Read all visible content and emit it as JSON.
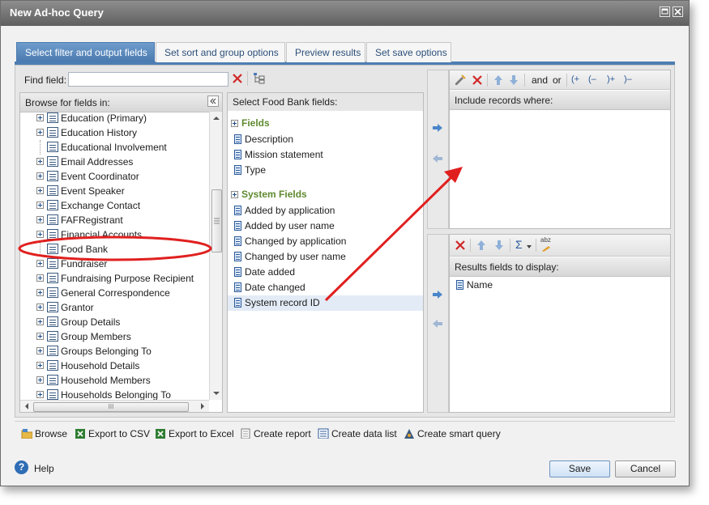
{
  "window": {
    "title": "New Ad-hoc Query"
  },
  "tabs": [
    {
      "label": "Select filter and output fields",
      "active": true
    },
    {
      "label": "Set sort and group options",
      "active": false
    },
    {
      "label": "Preview results",
      "active": false
    },
    {
      "label": "Set save options",
      "active": false
    }
  ],
  "find": {
    "label": "Find field:",
    "value": "",
    "placeholder": ""
  },
  "browse": {
    "header": "Browse for fields in:",
    "items": [
      {
        "label": "Education (Primary)",
        "expandable": true
      },
      {
        "label": "Education History",
        "expandable": true
      },
      {
        "label": "Educational Involvement",
        "expandable": false
      },
      {
        "label": "Email Addresses",
        "expandable": true
      },
      {
        "label": "Event Coordinator",
        "expandable": true
      },
      {
        "label": "Event Speaker",
        "expandable": true
      },
      {
        "label": "Exchange Contact",
        "expandable": true
      },
      {
        "label": "FAFRegistrant",
        "expandable": true
      },
      {
        "label": "Financial Accounts",
        "expandable": true
      },
      {
        "label": "Food Bank",
        "expandable": false,
        "selected": true
      },
      {
        "label": "Fundraiser",
        "expandable": true
      },
      {
        "label": "Fundraising Purpose Recipient",
        "expandable": true
      },
      {
        "label": "General Correspondence",
        "expandable": true
      },
      {
        "label": "Grantor",
        "expandable": true
      },
      {
        "label": "Group Details",
        "expandable": true
      },
      {
        "label": "Group Members",
        "expandable": true
      },
      {
        "label": "Groups Belonging To",
        "expandable": true
      },
      {
        "label": "Household Details",
        "expandable": true
      },
      {
        "label": "Household Members",
        "expandable": true
      },
      {
        "label": "Households Belonging To",
        "expandable": true
      }
    ],
    "hscroll_grip": "III"
  },
  "select_fields": {
    "header": "Select Food Bank fields:",
    "groups": [
      {
        "title": "Fields",
        "items": [
          "Description",
          "Mission statement",
          "Type"
        ]
      },
      {
        "title": "System Fields",
        "items": [
          "Added by application",
          "Added by user name",
          "Changed by application",
          "Changed by user name",
          "Date added",
          "Date changed",
          "System record ID"
        ]
      }
    ],
    "selected": "System record ID"
  },
  "filter": {
    "toolbar": {
      "and": "and",
      "or": "or",
      "open_paren_add": "(+",
      "open_paren_remove": "(–",
      "close_paren_add": ")+",
      "close_paren_remove": ")–"
    },
    "header": "Include records where:"
  },
  "results": {
    "header": "Results fields to display:",
    "sigma": "Σ",
    "sort_label": "abz",
    "items": [
      "Name"
    ]
  },
  "bottom_actions": [
    {
      "label": "Browse",
      "icon": "browse-folder-icon"
    },
    {
      "label": "Export to CSV",
      "icon": "excel-csv-icon"
    },
    {
      "label": "Export to Excel",
      "icon": "excel-icon"
    },
    {
      "label": "Create report",
      "icon": "report-icon"
    },
    {
      "label": "Create data list",
      "icon": "data-list-icon"
    },
    {
      "label": "Create smart query",
      "icon": "smart-query-icon"
    }
  ],
  "footer": {
    "help": "Help",
    "save": "Save",
    "cancel": "Cancel"
  },
  "colors": {
    "accent": "#4e7eb3",
    "group_title": "#5f8a2f",
    "annotation": "#e0201f"
  }
}
